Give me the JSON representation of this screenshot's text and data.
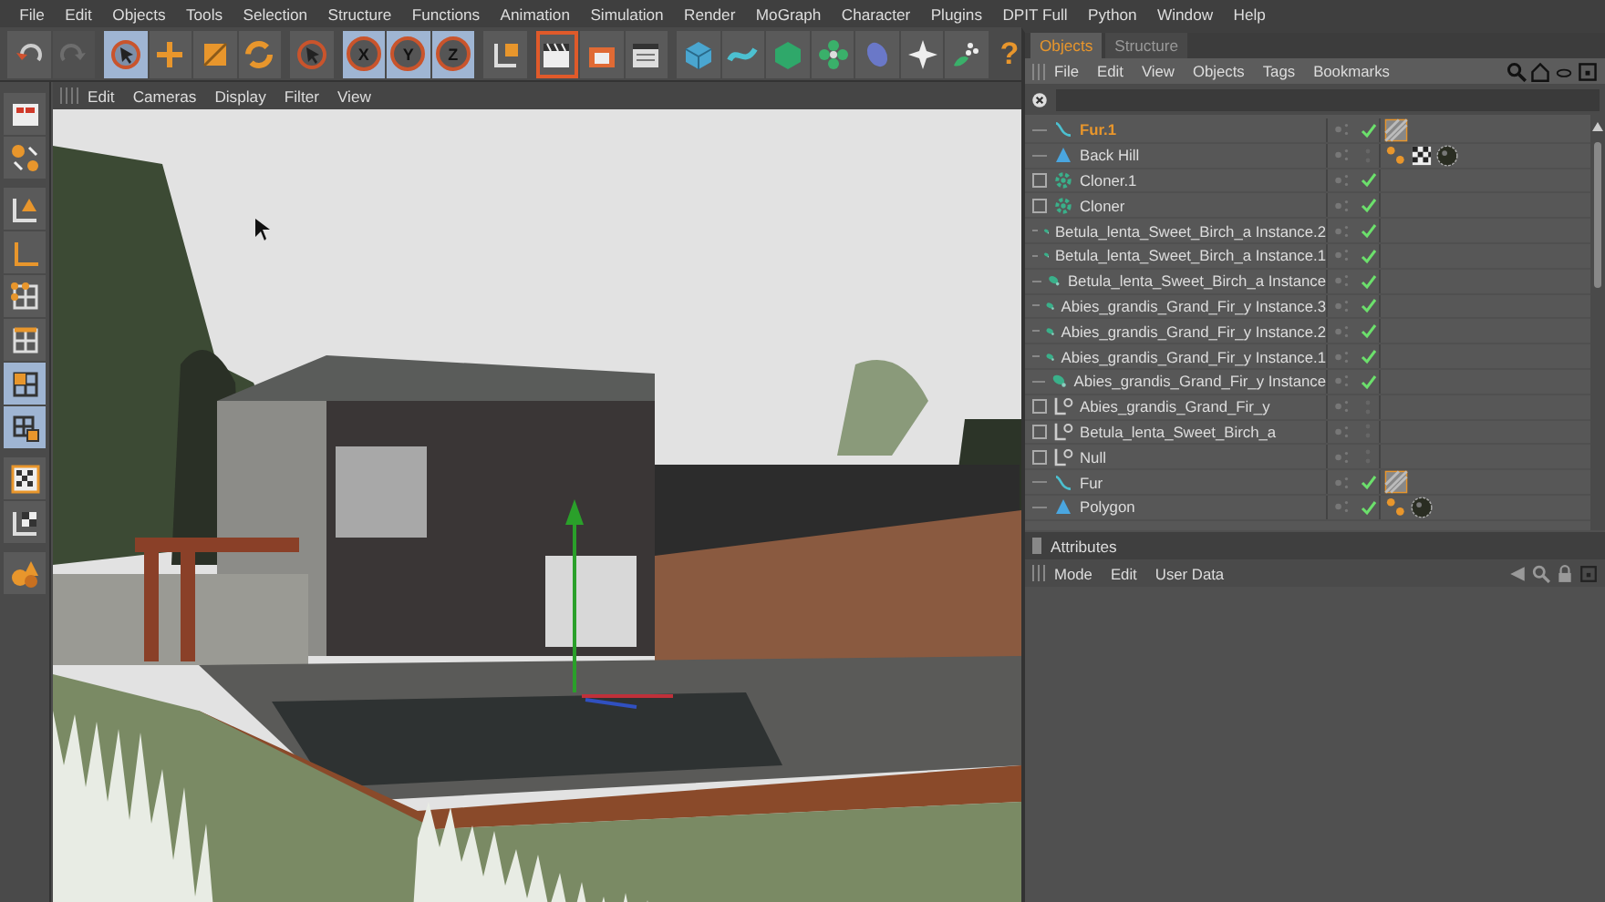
{
  "menu_bar": [
    "File",
    "Edit",
    "Objects",
    "Tools",
    "Selection",
    "Structure",
    "Functions",
    "Animation",
    "Simulation",
    "Render",
    "MoGraph",
    "Character",
    "Plugins",
    "DPIT Full",
    "Python",
    "Window",
    "Help"
  ],
  "toolbar": [
    {
      "kind": "undo",
      "selected": false,
      "disabled": false
    },
    {
      "kind": "redo",
      "selected": false,
      "disabled": true
    },
    {
      "kind": "select",
      "selected": true,
      "disabled": false
    },
    {
      "kind": "move",
      "selected": false,
      "disabled": false
    },
    {
      "kind": "scale",
      "selected": false,
      "disabled": false
    },
    {
      "kind": "rotate",
      "selected": false,
      "disabled": false
    },
    {
      "kind": "live",
      "selected": false,
      "disabled": false
    },
    {
      "kind": "axis",
      "label": "X",
      "selected": true,
      "disabled": false
    },
    {
      "kind": "axis",
      "label": "Y",
      "selected": true,
      "disabled": false
    },
    {
      "kind": "axis",
      "label": "Z",
      "selected": true,
      "disabled": false
    },
    {
      "kind": "coord",
      "selected": false,
      "disabled": false
    },
    {
      "kind": "render-view",
      "selected": true,
      "disabled": false
    },
    {
      "kind": "render",
      "selected": false,
      "disabled": false
    },
    {
      "kind": "render-settings",
      "selected": false,
      "disabled": false
    },
    {
      "kind": "cube",
      "selected": false,
      "disabled": false
    },
    {
      "kind": "spline",
      "selected": false,
      "disabled": false
    },
    {
      "kind": "nurbs",
      "selected": false,
      "disabled": false
    },
    {
      "kind": "array",
      "selected": false,
      "disabled": false
    },
    {
      "kind": "deformer",
      "selected": false,
      "disabled": false
    },
    {
      "kind": "scene",
      "selected": false,
      "disabled": false
    },
    {
      "kind": "environment",
      "selected": false,
      "disabled": false
    },
    {
      "kind": "help",
      "label": "?",
      "selected": false,
      "disabled": false
    }
  ],
  "sidebar": [
    {
      "kind": "layout",
      "selected": false
    },
    {
      "kind": "snap",
      "selected": false
    },
    {
      "kind": "model",
      "selected": false
    },
    {
      "kind": "object",
      "selected": false
    },
    {
      "kind": "points",
      "selected": false
    },
    {
      "kind": "edges",
      "selected": false
    },
    {
      "kind": "polygons",
      "selected": true
    },
    {
      "kind": "uv",
      "selected": true
    },
    {
      "kind": "texture",
      "selected": false
    },
    {
      "kind": "texture-axis",
      "selected": false
    },
    {
      "kind": "sculpt",
      "selected": false
    }
  ],
  "viewport": {
    "menu": [
      "Edit",
      "Cameras",
      "Display",
      "Filter",
      "View"
    ]
  },
  "objects_panel": {
    "tabs": [
      {
        "label": "Objects",
        "selected": true
      },
      {
        "label": "Structure",
        "selected": false
      }
    ],
    "menu": [
      "File",
      "Edit",
      "View",
      "Objects",
      "Tags",
      "Bookmarks"
    ],
    "rows": [
      {
        "name": "Fur.1",
        "kind": "fur",
        "selected": true,
        "expandable": false,
        "enabled": true,
        "tags": [
          {
            "kind": "hair"
          }
        ]
      },
      {
        "name": "Back Hill",
        "kind": "cone",
        "selected": false,
        "expandable": false,
        "enabled": false,
        "tags": [
          {
            "kind": "phong"
          },
          {
            "kind": "texture"
          },
          {
            "kind": "material"
          }
        ]
      },
      {
        "name": "Cloner.1",
        "kind": "cloner",
        "selected": false,
        "expandable": true,
        "enabled": true,
        "tags": []
      },
      {
        "name": "Cloner",
        "kind": "cloner",
        "selected": false,
        "expandable": true,
        "enabled": true,
        "tags": []
      },
      {
        "name": "Betula_lenta_Sweet_Birch_a Instance.2",
        "kind": "instance",
        "selected": false,
        "expandable": false,
        "enabled": true,
        "tags": []
      },
      {
        "name": "Betula_lenta_Sweet_Birch_a Instance.1",
        "kind": "instance",
        "selected": false,
        "expandable": false,
        "enabled": true,
        "tags": []
      },
      {
        "name": "Betula_lenta_Sweet_Birch_a Instance",
        "kind": "instance",
        "selected": false,
        "expandable": false,
        "enabled": true,
        "tags": []
      },
      {
        "name": "Abies_grandis_Grand_Fir_y Instance.3",
        "kind": "instance",
        "selected": false,
        "expandable": false,
        "enabled": true,
        "tags": []
      },
      {
        "name": "Abies_grandis_Grand_Fir_y Instance.2",
        "kind": "instance",
        "selected": false,
        "expandable": false,
        "enabled": true,
        "tags": []
      },
      {
        "name": "Abies_grandis_Grand_Fir_y Instance.1",
        "kind": "instance",
        "selected": false,
        "expandable": false,
        "enabled": true,
        "tags": []
      },
      {
        "name": "Abies_grandis_Grand_Fir_y Instance",
        "kind": "instance",
        "selected": false,
        "expandable": false,
        "enabled": true,
        "tags": []
      },
      {
        "name": "Abies_grandis_Grand_Fir_y",
        "kind": "null",
        "selected": false,
        "expandable": true,
        "enabled": false,
        "tags": []
      },
      {
        "name": "Betula_lenta_Sweet_Birch_a",
        "kind": "null",
        "selected": false,
        "expandable": true,
        "enabled": false,
        "tags": []
      },
      {
        "name": "Null",
        "kind": "null",
        "selected": false,
        "expandable": true,
        "enabled": false,
        "tags": []
      },
      {
        "name": "Fur",
        "kind": "fur",
        "selected": false,
        "expandable": false,
        "enabled": true,
        "tags": [
          {
            "kind": "hair"
          }
        ]
      },
      {
        "name": "Polygon",
        "kind": "cone",
        "selected": false,
        "expandable": false,
        "enabled": true,
        "tags": [
          {
            "kind": "phong"
          },
          {
            "kind": "material"
          }
        ]
      }
    ]
  },
  "attributes_panel": {
    "title": "Attributes",
    "menu": [
      "Mode",
      "Edit",
      "User Data"
    ]
  }
}
